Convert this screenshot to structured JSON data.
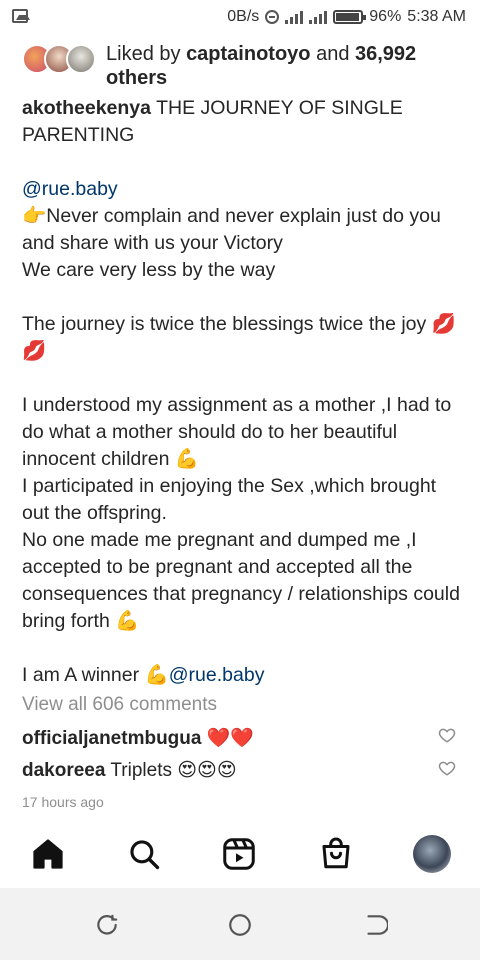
{
  "status_bar": {
    "net_speed": "0B/s",
    "battery": "96%",
    "time": "5:38 AM"
  },
  "likes": {
    "prefix": "Liked by ",
    "user": "captainotoyo",
    "middle": " and ",
    "count": "36,992",
    "suffix": "others"
  },
  "caption": {
    "username": "akotheekenya",
    "title": "THE JOURNEY OF SINGLE PARENTING",
    "mention": "@rue.baby",
    "line1_emoji": "👉",
    "line1": "Never complain  and never explain just do you and share with us your Victory",
    "line2": "We care very less by the way",
    "line3": "The journey is twice the blessings twice the joy",
    "line3_emoji": "💋💋",
    "line4": "I understood my assignment as a mother ,I had to do what a mother should do to her beautiful innocent children",
    "line4_emoji": "💪",
    "line5": "I participated in enjoying the Sex ,which brought out the offspring.",
    "line6": "No one made me pregnant and dumped me ,I accepted to be pregnant and accepted all the consequences that pregnancy / relationships could bring forth",
    "line6_emoji": "💪",
    "line7": "I am A winner",
    "line7_emoji": "💪",
    "line7_mention": "@rue.baby"
  },
  "view_comments": "View all 606 comments",
  "comments": [
    {
      "user": "officialjanetmbugua",
      "text": "❤️❤️"
    },
    {
      "user": "dakoreea",
      "text": "Triplets 😍😍😍"
    }
  ],
  "timestamp": "17 hours ago",
  "icons": {
    "gallery": "image-icon",
    "home": "home-icon",
    "search": "search-icon",
    "reels": "reels-icon",
    "shop": "shop-icon",
    "heart": "heart-outline-icon"
  }
}
